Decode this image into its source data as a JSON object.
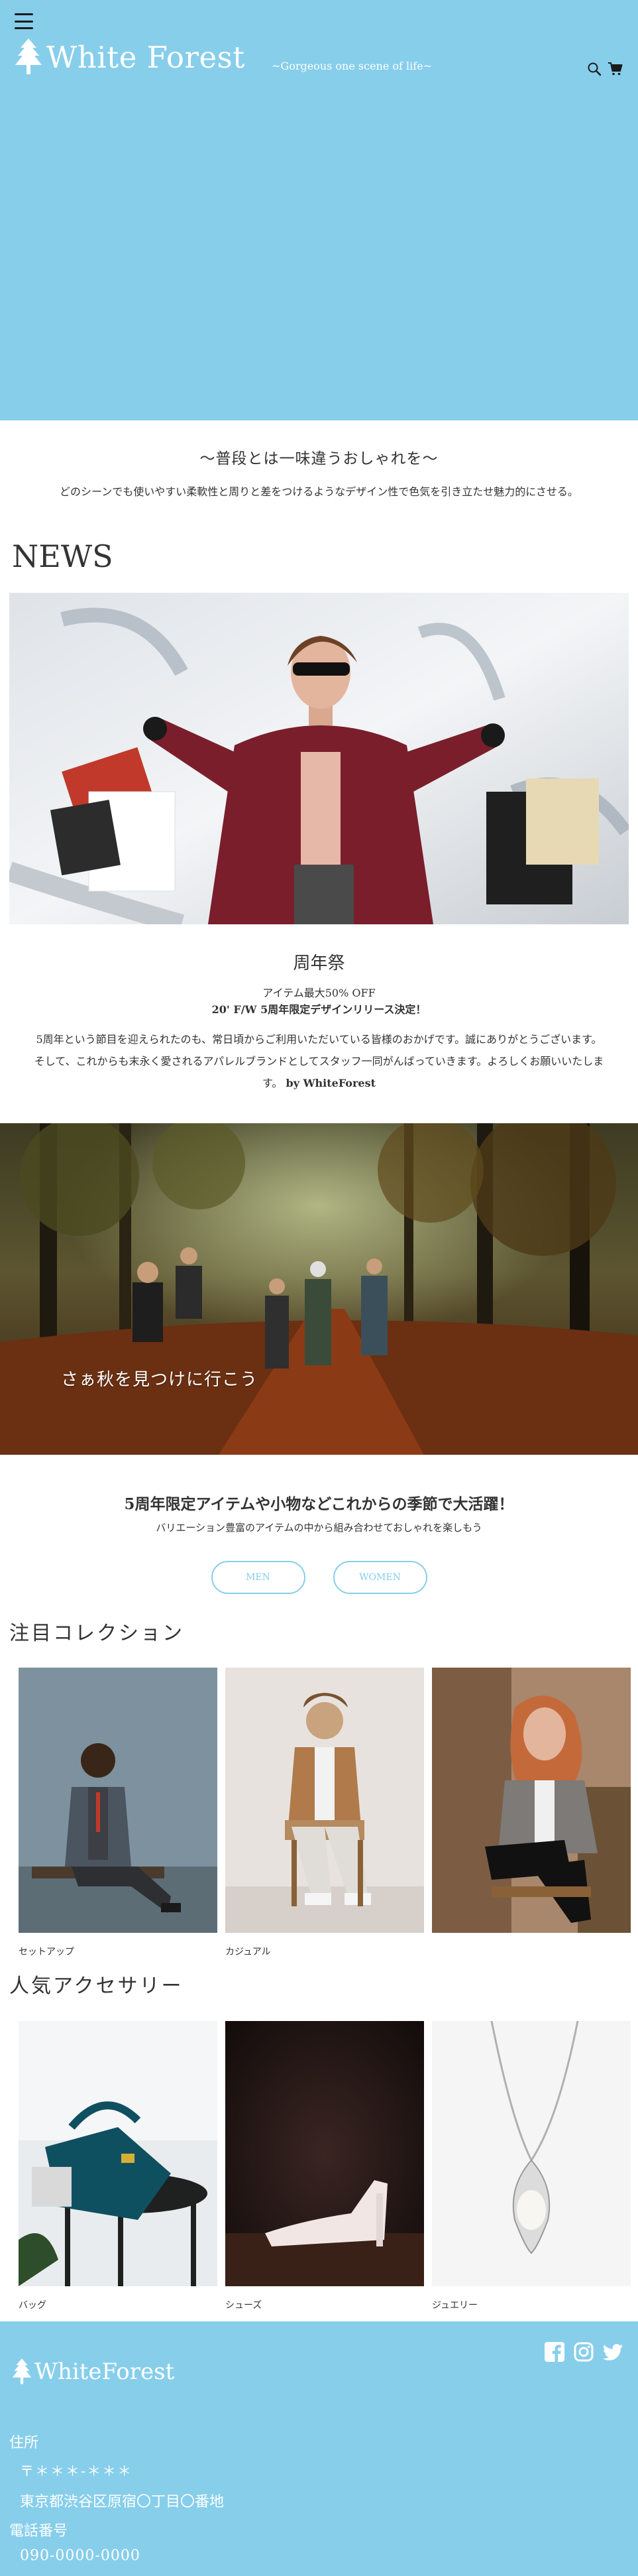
{
  "header": {
    "logo_text": "White Forest",
    "tagline": "~Gorgeous one scene of life~",
    "icons": [
      "menu-icon",
      "search-icon",
      "cart-icon"
    ]
  },
  "intro": {
    "title": "〜普段とは一味違うおしゃれを〜",
    "text": "どのシーンでも使いやすい柔軟性と周りと差をつけるようなデザイン性で色気を引き立たせ魅力的にさせる。"
  },
  "news": {
    "heading": "NEWS",
    "title": "周年祭",
    "line1": "アイテム最大50% OFF",
    "line2": "20' F/W 5周年限定デザインリリース決定！",
    "body": "5周年という節目を迎えられたのも、常日頃からご利用いただいている皆様のおかげです。誠にありがとうございます。そして、これからも末永く愛されるアパレルブランドとしてスタッフ一同がんばっていきます。よろしくお願いいたします。",
    "signature": "by WhiteForest"
  },
  "autumn": {
    "caption": "さぁ秋を見つけに行こう"
  },
  "promo": {
    "title": "5周年限定アイテムや小物などこれからの季節で大活躍！",
    "subtitle": "バリエーション豊富のアイテムの中から組み合わせておしゃれを楽しもう",
    "buttons": [
      "MEN",
      "WOMEN"
    ]
  },
  "collection": {
    "heading": "注目コレクション",
    "items": [
      "セットアップ",
      "カジュアル",
      ""
    ]
  },
  "accessory": {
    "heading": "人気アクセサリー",
    "items": [
      "バッグ",
      "シューズ",
      "ジュエリー"
    ]
  },
  "footer": {
    "logo_text": "WhiteForest",
    "address_label": "住所",
    "zip": "〒＊＊＊-＊＊＊",
    "address": "東京都渋谷区原宿〇丁目〇番地",
    "tel_label": "電話番号",
    "tel": "090-0000-0000",
    "social_icons": [
      "facebook-icon",
      "instagram-icon",
      "twitter-icon"
    ]
  },
  "colors": {
    "accent": "#87CEEB",
    "text": "#333333",
    "white": "#ffffff"
  }
}
